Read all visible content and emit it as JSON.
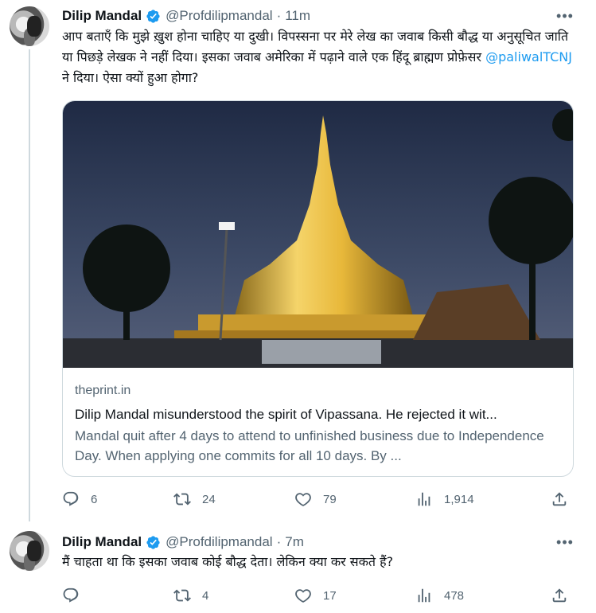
{
  "tweets": [
    {
      "name": "Dilip Mandal",
      "handle": "@Profdilipmandal",
      "separator": "·",
      "time": "11m",
      "text_parts": [
        "आप बताएँ कि मुझे ख़ुश होना चाहिए या दुखी। विपस्सना पर मेरे लेख का जवाब किसी बौद्ध या अनुसूचित जाति या पिछड़े लेखक ने नहीं दिया। इसका जवाब अमेरिका में पढ़ाने वाले एक हिंदू ब्राह्मण प्रोफ़ेसर ",
        "@paliwalTCNJ",
        " ने दिया। ऐसा क्यों हुआ होगा?"
      ],
      "card": {
        "domain": "theprint.in",
        "title": "Dilip Mandal misunderstood the spirit of Vipassana. He rejected it wit...",
        "description": "Mandal quit after 4 days to attend to unfinished business due to Independence Day. When applying one commits for all 10 days. By ..."
      },
      "stats": {
        "replies": "6",
        "retweets": "24",
        "likes": "79",
        "views": "1,914"
      }
    },
    {
      "name": "Dilip Mandal",
      "handle": "@Profdilipmandal",
      "separator": "·",
      "time": "7m",
      "text": "मैं चाहता था कि इसका जवाब कोई बौद्ध देता। लेकिन क्या कर सकते हैं?",
      "stats": {
        "replies": "",
        "retweets": "4",
        "likes": "17",
        "views": "478"
      }
    }
  ],
  "icons": {
    "verified": "verified-badge-icon",
    "more": "more-horizontal-icon",
    "reply": "reply-icon",
    "retweet": "retweet-icon",
    "like": "heart-icon",
    "views": "views-icon",
    "share": "share-icon"
  },
  "colors": {
    "accent": "#1d9bf0",
    "muted": "#536471",
    "text": "#0f1419",
    "border": "#cfd9de"
  }
}
